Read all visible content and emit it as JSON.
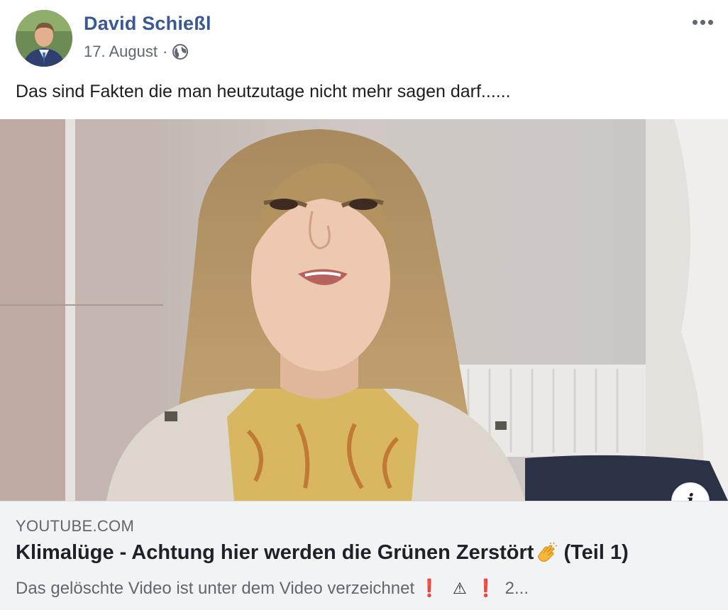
{
  "post": {
    "author": "David Schießl",
    "date": "17. August",
    "separator": "·",
    "privacy_icon": "globe-icon",
    "more_icon": "more-horizontal-icon",
    "text": "Das sind Fakten die man heutzutage nicht mehr sagen darf......"
  },
  "link_preview": {
    "domain": "YOUTUBE.COM",
    "title_main": "Klimalüge - Achtung hier werden die Grünen Zerstört",
    "title_suffix": "(Teil 1)",
    "title_icon": "clapping-hands-icon",
    "description_main": "Das gelöschte Video ist unter dem Video verzeichnet",
    "description_exclaim_1": "❗",
    "description_warning": "⚠",
    "description_exclaim_2": "❗",
    "description_tail": "2...",
    "info_icon": "info-icon",
    "info_label": "i"
  },
  "colors": {
    "author_link": "#385898",
    "secondary_text": "#606770",
    "primary_text": "#1c1e21",
    "preview_bg": "#f2f3f5",
    "alert_red": "#e0141e"
  }
}
